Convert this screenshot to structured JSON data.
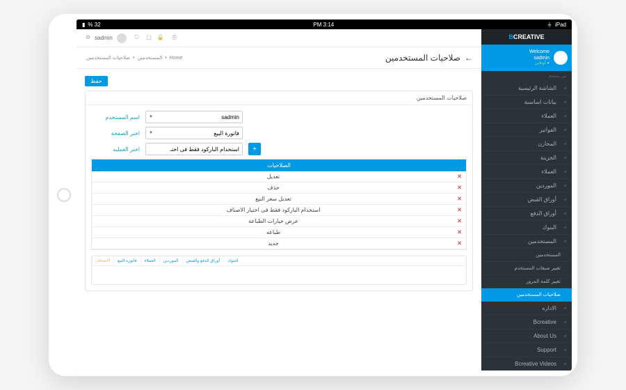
{
  "statusbar": {
    "device": "iPad",
    "time": "3:14 PM",
    "battery": "32 %"
  },
  "brand": {
    "pre": "B",
    "name": "CREATIVE"
  },
  "user": {
    "welcome": "Welcome",
    "name": "sadmin",
    "status": "● أونلاين"
  },
  "sections": {
    "main": "من يتصفح"
  },
  "sidebar": [
    {
      "label": "الشاشة الرئيسية"
    },
    {
      "label": "بيانات اساسية"
    },
    {
      "label": "العملاء"
    },
    {
      "label": "الفواتير"
    },
    {
      "label": "المخازن"
    },
    {
      "label": "الخزينة"
    },
    {
      "label": "العملاء"
    },
    {
      "label": "الموردين"
    },
    {
      "label": "أوراق القبض"
    },
    {
      "label": "أوراق الدفع"
    },
    {
      "label": "البنوك"
    },
    {
      "label": "المستخدمين"
    }
  ],
  "subitems": [
    {
      "label": "المستخدمين"
    },
    {
      "label": "تغيير صيغات المستخدم"
    },
    {
      "label": "تغيير كلمة المرور"
    },
    {
      "label": "صلاحيات المستخدمين",
      "active": true
    }
  ],
  "sidebar2": [
    {
      "label": "الاداره"
    },
    {
      "label": "Bcreative"
    },
    {
      "label": "About Us"
    },
    {
      "label": "Support"
    },
    {
      "label": "Bcreative Videos"
    }
  ],
  "topbar": {
    "user": "sadmin"
  },
  "page": {
    "title": "صلاحيات المستخدمين",
    "back": "←"
  },
  "breadcrumb": [
    "Home",
    "المستخدمين",
    "صلاحيات المستخدمين"
  ],
  "panel": {
    "title": "صلاحيات المستخدمين",
    "save": "حفظ"
  },
  "form": {
    "user_label": "اسم المستخدم",
    "user_value": "sadmin",
    "page_label": "اختر الصفحة",
    "page_value": "فاتورة البيع",
    "op_label": "اختر العمليه",
    "op_value": "استخدام الباركود فقط فى اختـ",
    "add": "+"
  },
  "table": {
    "header": "الصلاحيات",
    "rows": [
      "تعديل",
      "حذف",
      "تعديل سعر البيع",
      "استخدام الباركود فقط فى اختيار الاصناف",
      "عرض خيارات الطباعة",
      "طباعه",
      "جديد"
    ]
  },
  "tabs": [
    "الاصناف",
    "فاتورة البيع",
    "العملاء",
    "الموردين",
    "أوراق الدفع والقبض",
    "البنوك"
  ]
}
